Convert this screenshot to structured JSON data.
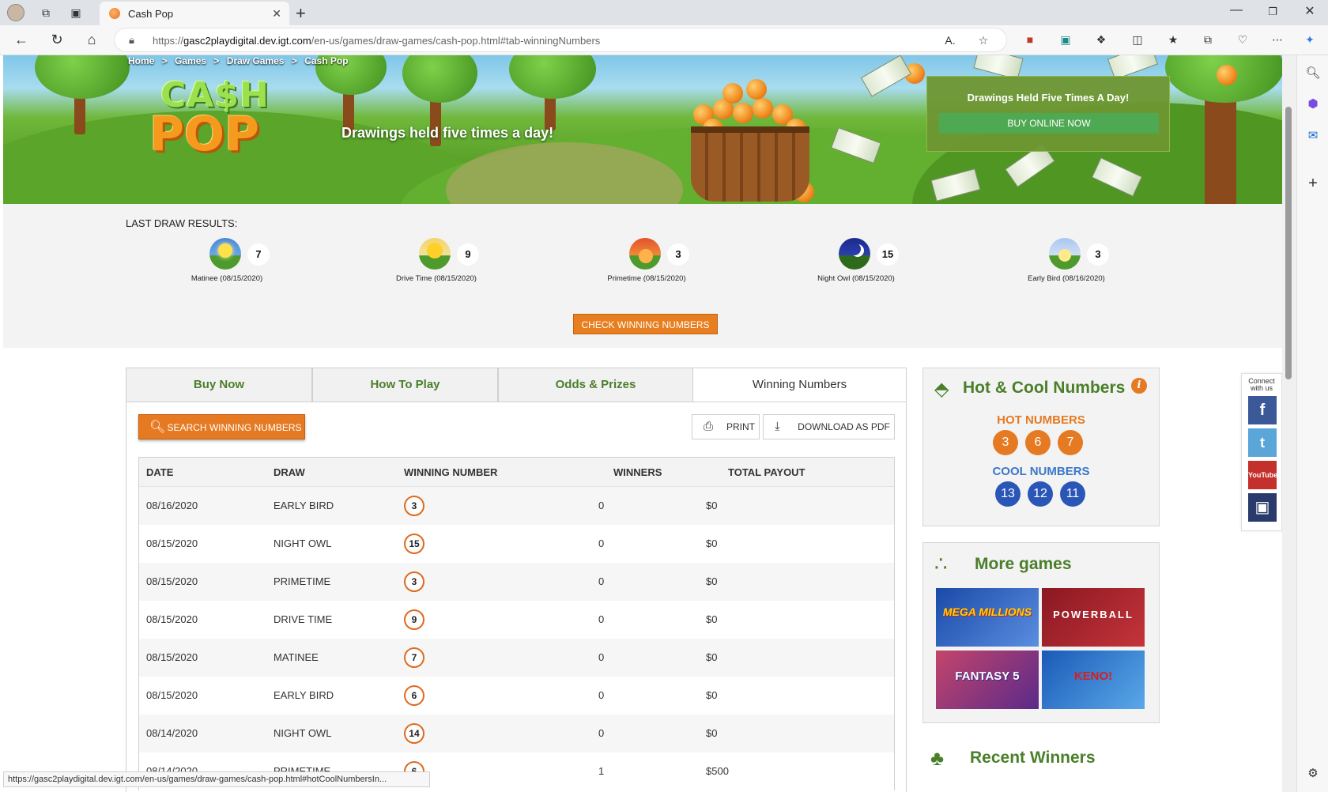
{
  "browser": {
    "tab_title": "Cash Pop",
    "url_prefix": "https://",
    "url_host": "gasc2playdigital.dev.igt.com",
    "url_path": "/en-us/games/draw-games/cash-pop.html#tab-winningNumbers",
    "status_url": "https://gasc2playdigital.dev.igt.com/en-us/games/draw-games/cash-pop.html#hotCoolNumbersIn..."
  },
  "breadcrumb": [
    "Home",
    ">",
    "Games",
    ">",
    "Draw Games",
    ">",
    "Cash Pop"
  ],
  "hero": {
    "logo_top": "CA$H",
    "logo_bottom": "POP",
    "tagline": "Drawings held five times a day!",
    "buy_box_heading": "Drawings Held Five Times A Day!",
    "buy_button": "BUY ONLINE NOW"
  },
  "last_draw": {
    "label": "LAST DRAW RESULTS:",
    "items": [
      {
        "caption": "Matinee (08/15/2020)",
        "number": "7",
        "icon": "sun-midday-icon"
      },
      {
        "caption": "Drive Time (08/15/2020)",
        "number": "9",
        "icon": "sun-afternoon-icon"
      },
      {
        "caption": "Primetime (08/15/2020)",
        "number": "3",
        "icon": "sunset-icon"
      },
      {
        "caption": "Night Owl (08/15/2020)",
        "number": "15",
        "icon": "moon-icon"
      },
      {
        "caption": "Early Bird (08/16/2020)",
        "number": "3",
        "icon": "sunrise-icon"
      }
    ],
    "check_button": "CHECK WINNING NUMBERS"
  },
  "tabs": [
    "Buy Now",
    "How To Play",
    "Odds & Prizes",
    "Winning Numbers"
  ],
  "panel": {
    "search_button": "SEARCH WINNING NUMBERS",
    "print_button": "PRINT",
    "pdf_button": "DOWNLOAD AS PDF"
  },
  "table": {
    "headers": [
      "DATE",
      "DRAW",
      "WINNING NUMBER",
      "WINNERS",
      "TOTAL PAYOUT"
    ],
    "rows": [
      {
        "date": "08/16/2020",
        "draw": "EARLY BIRD",
        "number": "3",
        "winners": "0",
        "payout": "$0"
      },
      {
        "date": "08/15/2020",
        "draw": "NIGHT OWL",
        "number": "15",
        "winners": "0",
        "payout": "$0"
      },
      {
        "date": "08/15/2020",
        "draw": "PRIMETIME",
        "number": "3",
        "winners": "0",
        "payout": "$0"
      },
      {
        "date": "08/15/2020",
        "draw": "DRIVE TIME",
        "number": "9",
        "winners": "0",
        "payout": "$0"
      },
      {
        "date": "08/15/2020",
        "draw": "MATINEE",
        "number": "7",
        "winners": "0",
        "payout": "$0"
      },
      {
        "date": "08/15/2020",
        "draw": "EARLY BIRD",
        "number": "6",
        "winners": "0",
        "payout": "$0"
      },
      {
        "date": "08/14/2020",
        "draw": "NIGHT OWL",
        "number": "14",
        "winners": "0",
        "payout": "$0"
      },
      {
        "date": "08/14/2020",
        "draw": "PRIMETIME",
        "number": "6",
        "winners": "1",
        "payout": "$500"
      }
    ]
  },
  "hot_cool": {
    "title": "Hot & Cool Numbers",
    "hot_label": "HOT NUMBERS",
    "hot": [
      "3",
      "6",
      "7"
    ],
    "cool_label": "COOL NUMBERS",
    "cool": [
      "13",
      "12",
      "11"
    ],
    "hot_color": "#e57a23",
    "cool_color": "#2a56b8"
  },
  "more_games": {
    "title": "More games",
    "tiles": [
      {
        "label": "MEGA MILLIONS"
      },
      {
        "label": "POWERBALL"
      },
      {
        "label": "FANTASY 5"
      },
      {
        "label": "KENO!"
      }
    ]
  },
  "recent_winners": {
    "title": "Recent Winners"
  },
  "social": {
    "caption": "Connect with us",
    "items": [
      "f",
      "t",
      "YouTube",
      "instagram"
    ]
  }
}
